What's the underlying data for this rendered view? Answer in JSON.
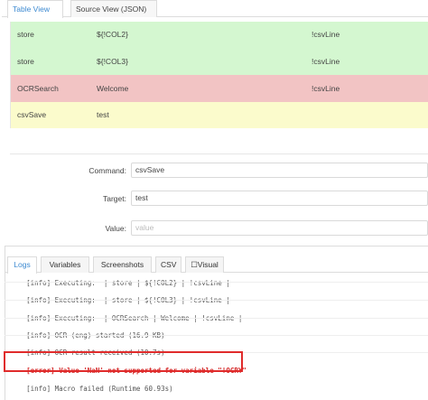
{
  "top_tabs": [
    {
      "label": "Table View",
      "active": true
    },
    {
      "label": "Source View (JSON)",
      "active": false
    }
  ],
  "commands": [
    {
      "command": "store",
      "target": "${!COL2}",
      "value": "!csvLine",
      "status": "success"
    },
    {
      "command": "store",
      "target": "${!COL3}",
      "value": "!csvLine",
      "status": "success"
    },
    {
      "command": "OCRSearch",
      "target": "Welcome",
      "value": "!csvLine",
      "status": "error"
    },
    {
      "command": "csvSave",
      "target": "test",
      "value": "",
      "status": "selected"
    }
  ],
  "editor": {
    "command_label": "Command:",
    "command_value": "csvSave",
    "target_label": "Target:",
    "target_value": "test",
    "value_label": "Value:",
    "value_placeholder": "value"
  },
  "bottom_tabs": [
    {
      "label": "Logs",
      "active": true
    },
    {
      "label": "Variables",
      "active": false
    },
    {
      "label": "Screenshots",
      "active": false
    },
    {
      "label": "CSV",
      "active": false
    },
    {
      "label": "☐Visual",
      "active": false
    }
  ],
  "logs": [
    {
      "tag": "[info]",
      "text": "Executing:  | store | ${!COL2} | !csvLine |",
      "level": "info"
    },
    {
      "tag": "[info]",
      "text": "Executing:  | store | ${!COL3} | !csvLine |",
      "level": "info"
    },
    {
      "tag": "[info]",
      "text": "Executing:  | OCRSearch | Welcome | !csvLine |",
      "level": "info"
    },
    {
      "tag": "[info]",
      "text": "OCR (eng) started (16.9 KB)",
      "level": "info"
    },
    {
      "tag": "[info]",
      "text": "OCR result received (10.7s)",
      "level": "info"
    },
    {
      "tag": "[error]",
      "text": "Value 'NaN' not supported for variable \"!OCRY\"",
      "level": "error"
    },
    {
      "tag": "[info]",
      "text": "Macro failed (Runtime 60.93s)",
      "level": "info"
    }
  ],
  "colors": {
    "success_row": "#d4f7d0",
    "error_row": "#f2c4c4",
    "selected_row": "#fbfbcc",
    "active_tab": "#3d8ad1",
    "error_text": "#d62b2b",
    "highlight": "#e02b2b"
  }
}
